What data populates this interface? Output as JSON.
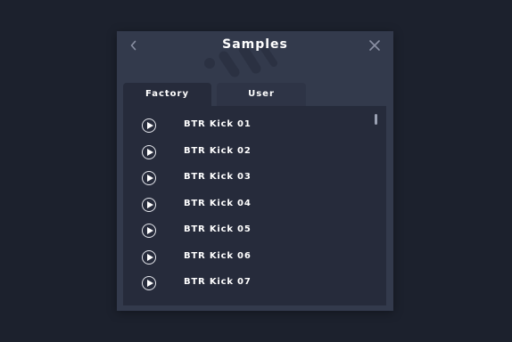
{
  "window": {
    "title": "Samples",
    "back_icon": "chevron-left-icon",
    "close_icon": "close-icon"
  },
  "tabs": [
    {
      "label": "Factory",
      "active": true
    },
    {
      "label": "User",
      "active": false
    }
  ],
  "samples": [
    {
      "name": "BTR Kick 01",
      "icon": "play-icon"
    },
    {
      "name": "BTR Kick 02",
      "icon": "play-icon"
    },
    {
      "name": "BTR Kick 03",
      "icon": "play-icon"
    },
    {
      "name": "BTR Kick 04",
      "icon": "play-icon"
    },
    {
      "name": "BTR Kick 05",
      "icon": "play-icon"
    },
    {
      "name": "BTR Kick 06",
      "icon": "play-icon"
    },
    {
      "name": "BTR Kick 07",
      "icon": "play-icon"
    }
  ],
  "colors": {
    "background": "#1c212d",
    "panel": "#333a4c",
    "list_background": "#262b3b",
    "text": "#ffffff"
  }
}
